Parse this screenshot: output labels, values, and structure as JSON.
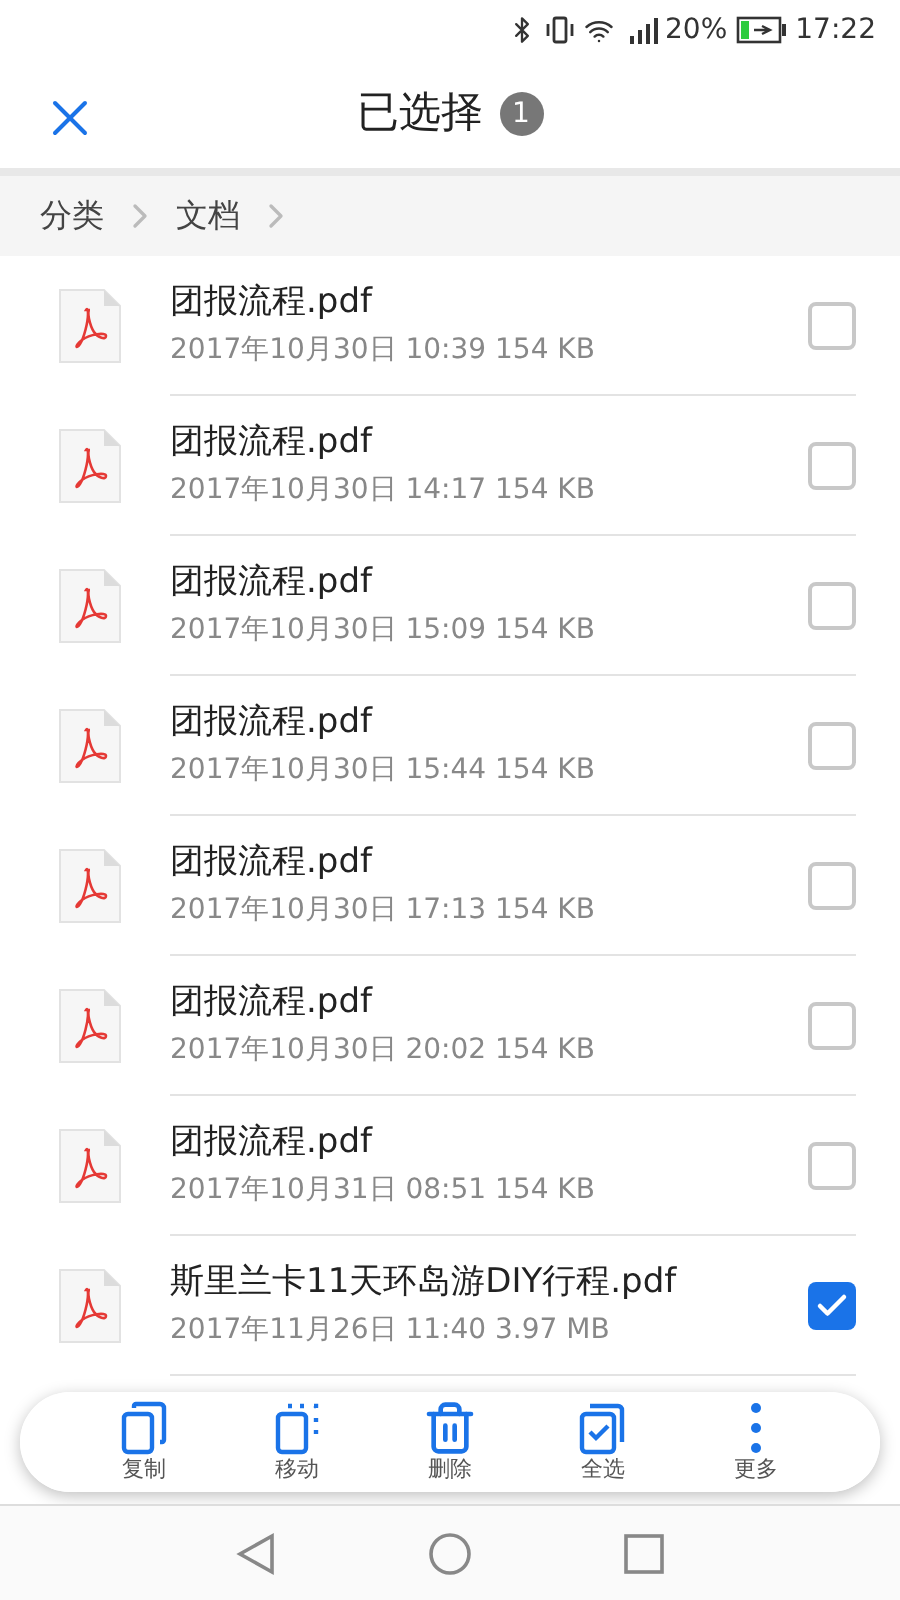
{
  "status_bar": {
    "battery": "20%",
    "time": "17:22"
  },
  "header": {
    "title": "已选择",
    "count": "1"
  },
  "breadcrumb": [
    "分类",
    "文档"
  ],
  "files": [
    {
      "name": "团报流程.pdf",
      "meta": "2017年10月30日 10:39 154 KB",
      "selected": false
    },
    {
      "name": "团报流程.pdf",
      "meta": "2017年10月30日 14:17 154 KB",
      "selected": false
    },
    {
      "name": "团报流程.pdf",
      "meta": "2017年10月30日 15:09 154 KB",
      "selected": false
    },
    {
      "name": "团报流程.pdf",
      "meta": "2017年10月30日 15:44 154 KB",
      "selected": false
    },
    {
      "name": "团报流程.pdf",
      "meta": "2017年10月30日 17:13 154 KB",
      "selected": false
    },
    {
      "name": "团报流程.pdf",
      "meta": "2017年10月30日 20:02 154 KB",
      "selected": false
    },
    {
      "name": "团报流程.pdf",
      "meta": "2017年10月31日 08:51 154 KB",
      "selected": false
    },
    {
      "name": "斯里兰卡11天环岛游DIY行程.pdf",
      "meta": "2017年11月26日 11:40 3.97 MB",
      "selected": true
    }
  ],
  "toolbar": [
    {
      "kind": "copy",
      "label": "复制"
    },
    {
      "kind": "move",
      "label": "移动"
    },
    {
      "kind": "delete",
      "label": "删除"
    },
    {
      "kind": "select_all",
      "label": "全选"
    },
    {
      "kind": "more",
      "label": "更多"
    }
  ]
}
